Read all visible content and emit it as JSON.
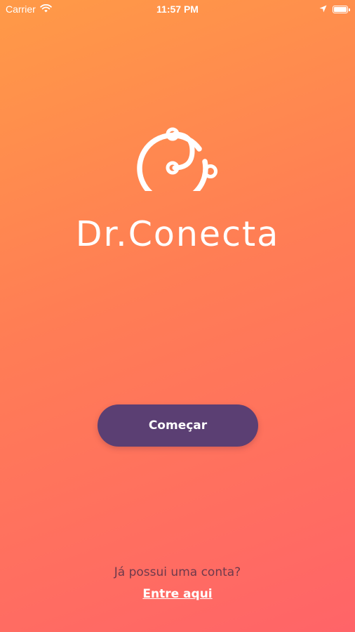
{
  "status_bar": {
    "carrier": "Carrier",
    "time": "11:57 PM",
    "battery_level": 0.9
  },
  "icons": {
    "wifi": "wifi-icon",
    "location": "location-arrow-icon",
    "battery": "battery-icon",
    "logo": "stethoscope-logo-icon"
  },
  "brand": {
    "name": "Dr.Conecta"
  },
  "actions": {
    "start_label": "Começar",
    "account_question": "Já possui uma conta?",
    "login_label": "Entre aqui"
  },
  "colors": {
    "gradient_top": "#ff9a47",
    "gradient_bottom": "#ff6468",
    "button": "#5b3f73",
    "question_text": "#6d3a4c"
  }
}
